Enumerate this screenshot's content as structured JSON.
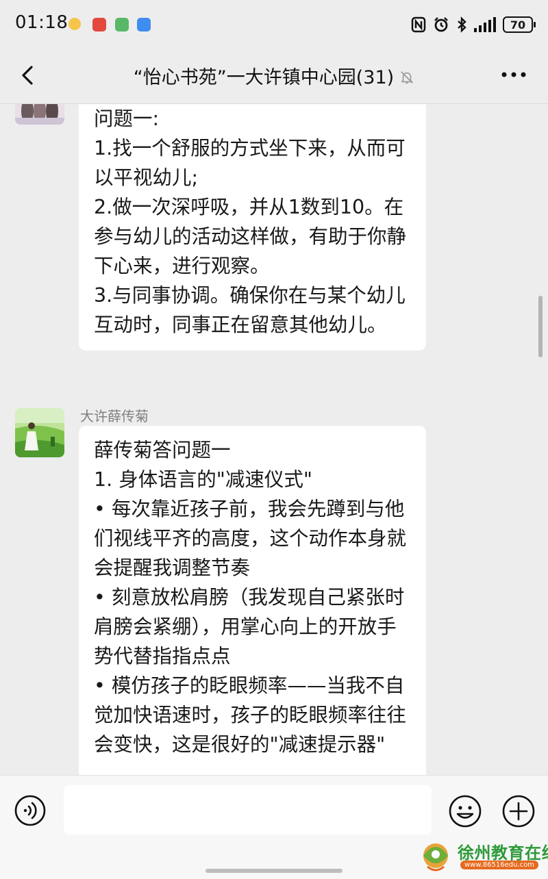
{
  "status_bar": {
    "time": "01:18",
    "battery": "70",
    "icons": [
      "nfc-icon",
      "alarm-icon",
      "bluetooth-icon",
      "signal-icon",
      "battery-icon"
    ]
  },
  "header": {
    "title": "“怡心书苑”一大许镇中心园(31)",
    "icons": [
      "back-arrow-icon",
      "mute-bell-icon",
      "more-dots-icon"
    ]
  },
  "messages": [
    {
      "sender": "",
      "text": "问题一:\n1.找一个舒服的方式坐下来，从而可以平视幼儿;\n2.做一次深呼吸，并从1数到10。在参与幼儿的活动这样做，有助于你静下心来，进行观察。\n3.与同事协调。确保你在与某个幼儿互动时，同事正在留意其他幼儿。"
    },
    {
      "sender": "大许薛传菊",
      "text": "薛传菊答问题一\n1. 身体语言的\"减速仪式\"\n• 每次靠近孩子前，我会先蹲到与他们视线平齐的高度，这个动作本身就会提醒我调整节奏\n• 刻意放松肩膀（我发现自己紧张时肩膀会紧绷），用掌心向上的开放手势代替指指点点\n• 模仿孩子的眨眼频率——当我不自觉加快语速时，孩子的眨眼频率往往会变快，这是很好的\"减速提示器\""
    }
  ],
  "input_bar": {
    "placeholder": "",
    "icons": [
      "voice-icon",
      "emoji-icon",
      "plus-icon"
    ]
  },
  "watermark": {
    "title": "徐州教育在线",
    "url": "www.86516edu.com"
  }
}
